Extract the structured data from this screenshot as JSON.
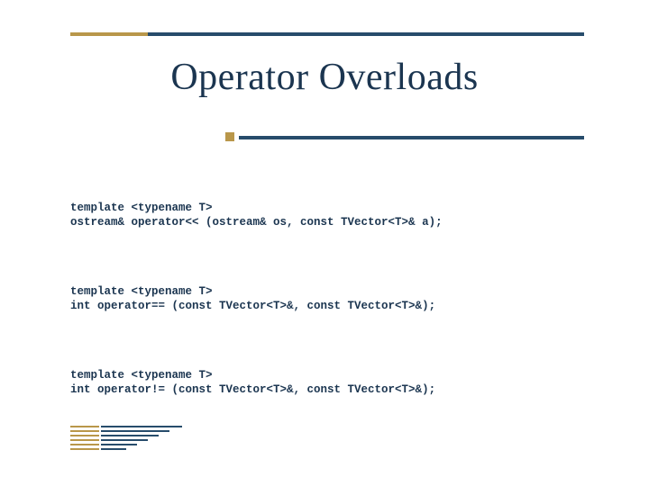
{
  "title": "Operator Overloads",
  "code": {
    "block1_line1": "template <typename T>",
    "block1_line2": "ostream& operator<< (ostream& os, const TVector<T>& a);",
    "block2_line1": "template <typename T>",
    "block2_line2": "int operator== (const TVector<T>&, const TVector<T>&);",
    "block3_line1": "template <typename T>",
    "block3_line2": "int operator!= (const TVector<T>&, const TVector<T>&);"
  }
}
